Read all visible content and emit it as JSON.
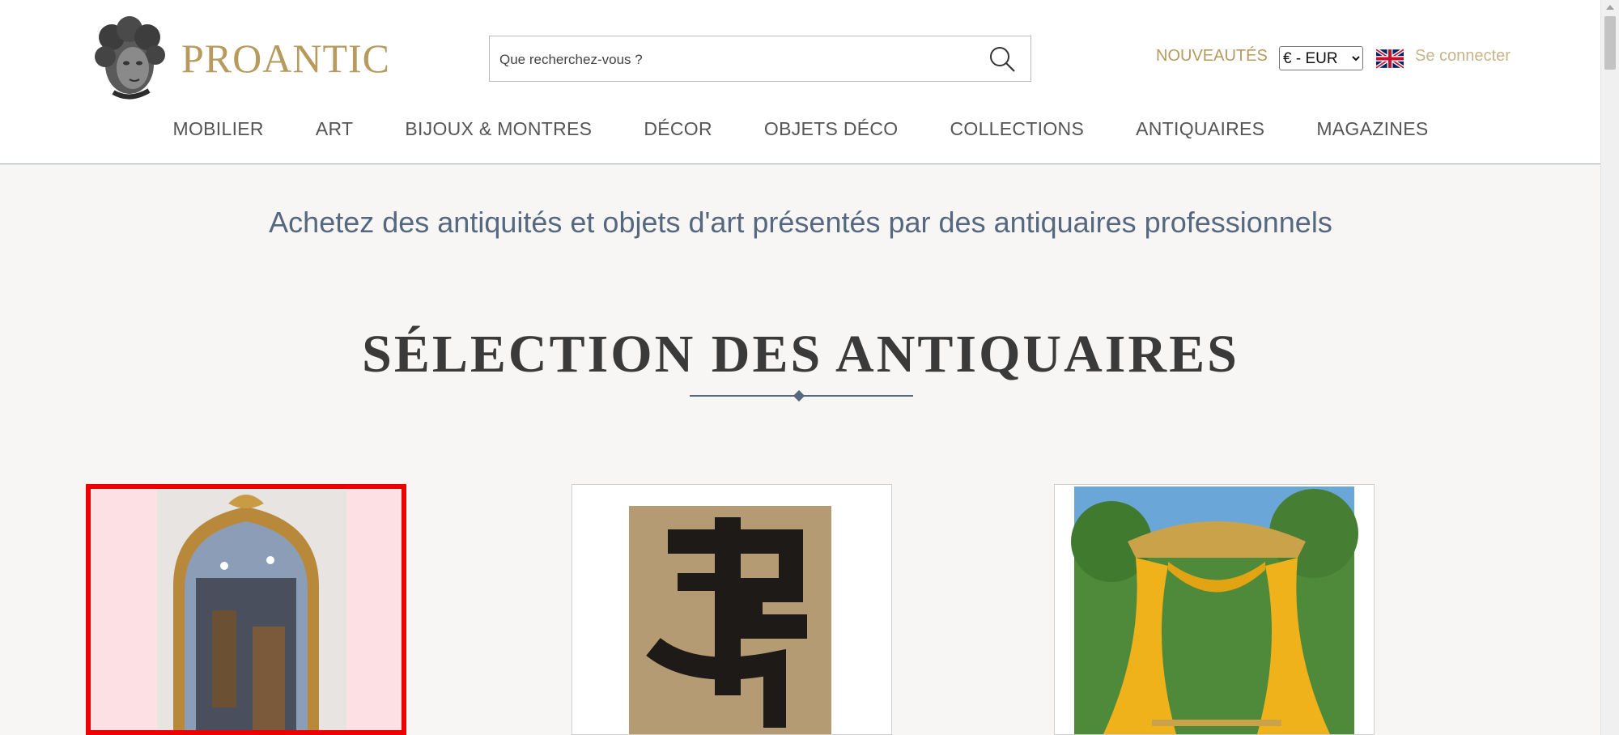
{
  "brand": {
    "name": "PROANTIC"
  },
  "search": {
    "placeholder": "Que recherchez-vous ?"
  },
  "header_links": {
    "new_label": "NOUVEAUTÉS",
    "currency": "€ - EUR",
    "signin_label": "Se connecter"
  },
  "nav": {
    "items": [
      {
        "label": "MOBILIER"
      },
      {
        "label": "ART"
      },
      {
        "label": "BIJOUX & MONTRES"
      },
      {
        "label": "DÉCOR"
      },
      {
        "label": "OBJETS DÉCO"
      },
      {
        "label": "COLLECTIONS"
      },
      {
        "label": "ANTIQUAIRES"
      },
      {
        "label": "MAGAZINES"
      }
    ]
  },
  "hero": {
    "tagline": "Achetez des antiquités et objets d'art présentés par des antiquaires professionnels"
  },
  "section": {
    "title": "SÉLECTION DES ANTIQUAIRES"
  },
  "colors": {
    "gold": "#b69a5e",
    "slate": "#55687f",
    "selection_border": "#ee0000",
    "selection_fill": "#fde0e3"
  },
  "icons": {
    "search": "search-icon",
    "flag": "uk-flag-icon",
    "logo": "cherub-head-icon"
  }
}
